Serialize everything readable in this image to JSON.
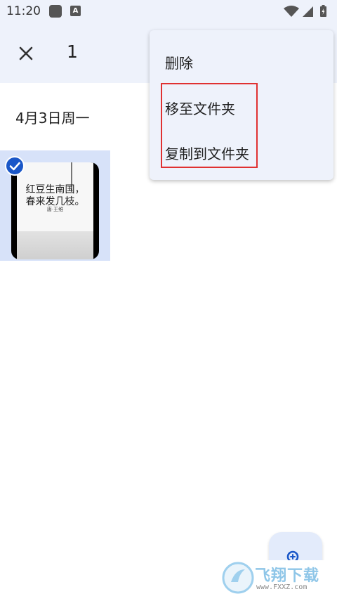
{
  "status_bar": {
    "time": "11:20",
    "icons": [
      "app-icon",
      "a-icon",
      "wifi-icon",
      "signal-icon",
      "battery-icon"
    ],
    "app_badge": "A"
  },
  "top_bar": {
    "close_icon": "close-icon",
    "selected_count": "1"
  },
  "gallery": {
    "date_header": "4月3日周一",
    "photo": {
      "poem_line1": "红豆生南国，",
      "poem_line2": "春来发几枝。",
      "author": "唐·王维",
      "selected": true
    }
  },
  "overflow_menu": {
    "items": [
      {
        "label": "删除"
      },
      {
        "label": "移至文件夹"
      },
      {
        "label": "复制到文件夹"
      }
    ],
    "highlight_color": "#e03131"
  },
  "fab": {
    "icon": "zoom-in-icon"
  },
  "watermark": {
    "text": "飞翔下载",
    "url": "www.FXXZ.com"
  },
  "colors": {
    "accent": "#1a57c8",
    "surface": "#eef2fb",
    "selected_bg": "#d7e2f9"
  }
}
